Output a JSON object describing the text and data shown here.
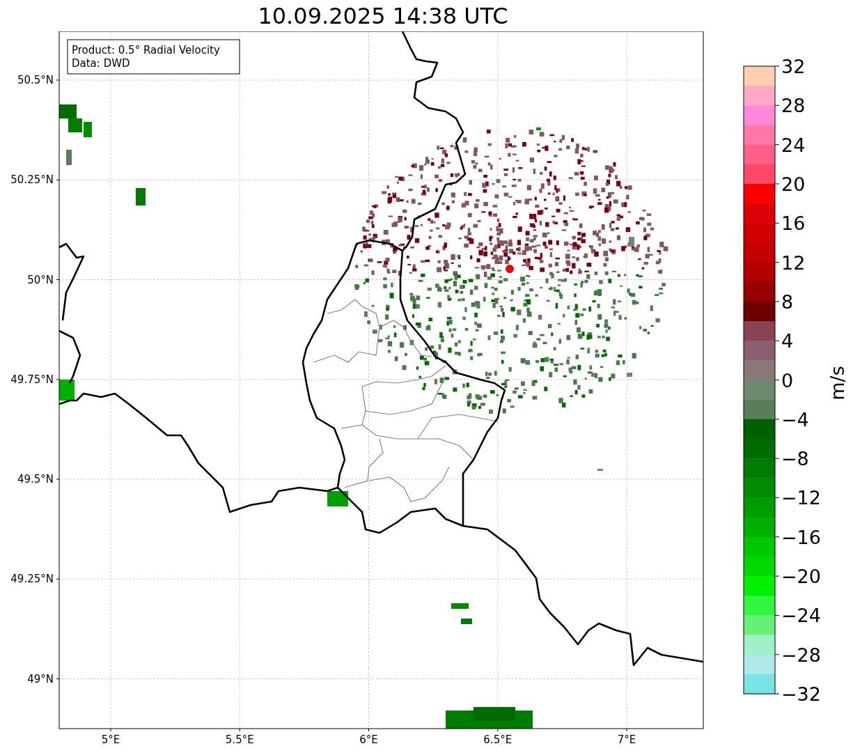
{
  "title": "10.09.2025 14:38 UTC",
  "map": {
    "legend": [
      "Product: 0.5° Radial Velocity",
      "Data: DWD"
    ],
    "x_tick_labels": [
      "5°E",
      "5.5°E",
      "6°E",
      "6.5°E",
      "7°E"
    ],
    "y_tick_labels": [
      "50.5°N",
      "50.25°N",
      "50°N",
      "49.75°N",
      "49.5°N",
      "49.25°N",
      "49°N"
    ]
  },
  "colorbar": {
    "label": "m/s",
    "tick_labels": [
      "32",
      "28",
      "24",
      "20",
      "16",
      "12",
      "8",
      "4",
      "0",
      "−4",
      "−8",
      "−12",
      "−16",
      "−20",
      "−24",
      "−28",
      "−32"
    ],
    "segments": [
      {
        "color": "#ffcfb0"
      },
      {
        "color": "#ffa8c8"
      },
      {
        "color": "#ff88d8"
      },
      {
        "color": "#ff78a8"
      },
      {
        "color": "#ff6088"
      },
      {
        "color": "#ff4868"
      },
      {
        "color": "#f80000"
      },
      {
        "color": "#e00008"
      },
      {
        "color": "#d00000"
      },
      {
        "color": "#c40000"
      },
      {
        "color": "#b00000"
      },
      {
        "color": "#980000"
      },
      {
        "color": "#6c0000"
      },
      {
        "color": "#884450"
      },
      {
        "color": "#8a6070"
      },
      {
        "color": "#8a7878"
      },
      {
        "color": "#6e8a6e"
      },
      {
        "color": "#5a7d5a"
      },
      {
        "color": "#006000"
      },
      {
        "color": "#006c00"
      },
      {
        "color": "#007c00"
      },
      {
        "color": "#008c00"
      },
      {
        "color": "#009c00"
      },
      {
        "color": "#00b000"
      },
      {
        "color": "#00c800"
      },
      {
        "color": "#00d800"
      },
      {
        "color": "#00f000"
      },
      {
        "color": "#30f840"
      },
      {
        "color": "#66f078"
      },
      {
        "color": "#a0f0c8"
      },
      {
        "color": "#b0e8ec"
      },
      {
        "color": "#78e4e8"
      }
    ]
  }
}
